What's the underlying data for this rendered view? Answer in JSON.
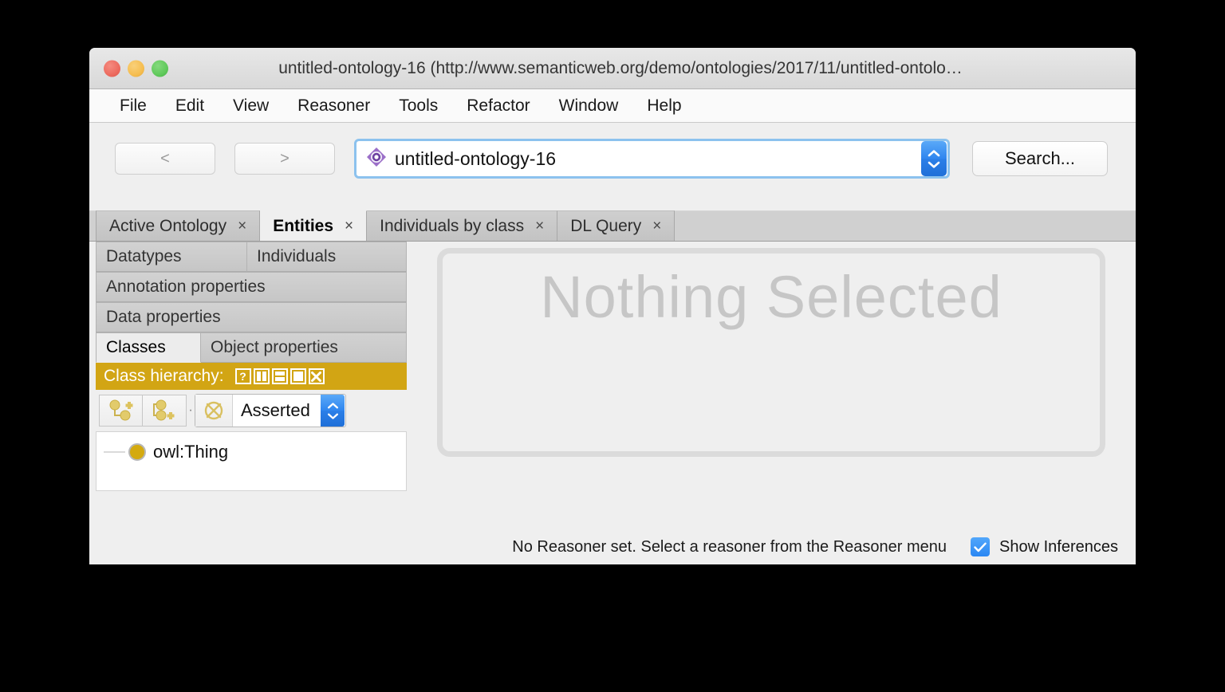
{
  "window": {
    "title": "untitled-ontology-16 (http://www.semanticweb.org/demo/ontologies/2017/11/untitled-ontolo…",
    "traffic_lights": {
      "close": "close-button",
      "minimize": "minimize-button",
      "maximize": "maximize-button"
    },
    "colors": {
      "close": "#ec6a5e",
      "minimize": "#f5bd4f",
      "maximize": "#5fc95a",
      "accent_blue": "#2a87f3",
      "hierarchy_gold": "#d2a514",
      "owl_thing_yellow": "#d4aa10"
    }
  },
  "menubar": {
    "items": [
      {
        "label": "File"
      },
      {
        "label": "Edit"
      },
      {
        "label": "View"
      },
      {
        "label": "Reasoner"
      },
      {
        "label": "Tools"
      },
      {
        "label": "Refactor"
      },
      {
        "label": "Window"
      },
      {
        "label": "Help"
      }
    ]
  },
  "toolbar": {
    "back_label": "<",
    "forward_label": ">",
    "ontology_value": "untitled-ontology-16",
    "ontology_icon": "ontology-icon",
    "stepper_icon": "up-down-stepper-icon",
    "search_label": "Search..."
  },
  "tabs": [
    {
      "label": "Active Ontology",
      "close": "×",
      "active": false
    },
    {
      "label": "Entities",
      "close": "×",
      "active": true
    },
    {
      "label": "Individuals by class",
      "close": "×",
      "active": false
    },
    {
      "label": "DL Query",
      "close": "×",
      "active": false
    }
  ],
  "left_panel": {
    "subtabs_row1": [
      {
        "label": "Datatypes"
      },
      {
        "label": "Individuals"
      }
    ],
    "subtabs_row2": [
      {
        "label": "Annotation properties"
      }
    ],
    "subtabs_row3": [
      {
        "label": "Data properties"
      }
    ],
    "subtabs_row4": [
      {
        "label": "Classes",
        "active": true
      },
      {
        "label": "Object properties",
        "active": false
      }
    ],
    "class_hierarchy": {
      "title": "Class hierarchy:",
      "header_icons": [
        {
          "name": "help-icon",
          "glyph": "?"
        },
        {
          "name": "split-vertical-icon",
          "glyph": ""
        },
        {
          "name": "split-horizontal-icon",
          "glyph": ""
        },
        {
          "name": "maximize-panel-icon",
          "glyph": ""
        },
        {
          "name": "close-panel-icon",
          "glyph": "×"
        }
      ],
      "buttons": [
        {
          "name": "add-subclass-button"
        },
        {
          "name": "add-sibling-class-button"
        }
      ],
      "separator": "·",
      "view_combo": {
        "icon": "no-reasoner-icon",
        "value": "Asserted"
      },
      "tree": [
        {
          "label": "owl:Thing",
          "icon": "owl-class-icon",
          "depth": 0
        }
      ]
    }
  },
  "right_panel": {
    "nothing_selected": "Nothing Selected"
  },
  "statusbar": {
    "reasoner_status": "No Reasoner set. Select a reasoner from the Reasoner menu",
    "show_inferences_label": "Show Inferences",
    "show_inferences_checked": true,
    "checkbox_icon": "checkmark-icon"
  }
}
